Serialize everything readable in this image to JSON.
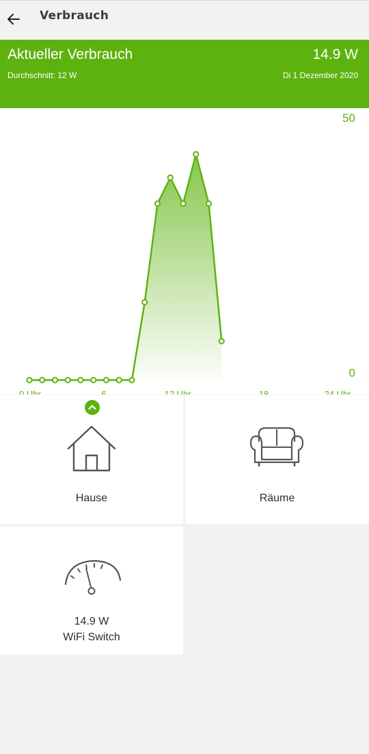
{
  "header": {
    "title": "Verbrauch"
  },
  "banner": {
    "title": "Aktueller Verbrauch",
    "value": "14.9 W",
    "average": "Durchschnitt: 12 W",
    "date": "Di 1 Dezember 2020"
  },
  "chart_data": {
    "type": "area",
    "ylim": [
      0,
      50
    ],
    "y_tick_labels": [
      "50",
      "0"
    ],
    "x_tick_labels": [
      "0 Uhr",
      "6",
      "12 Uhr",
      "18",
      "24 Uhr"
    ],
    "xlim": [
      0,
      24
    ],
    "color": "#5db210",
    "x": [
      0,
      1,
      2,
      3,
      4,
      5,
      6,
      7,
      8,
      9,
      10,
      11,
      12,
      13,
      14,
      15
    ],
    "values": [
      0,
      0,
      0,
      0,
      0,
      0,
      0,
      0,
      0,
      15,
      34,
      39,
      34,
      43.5,
      34,
      7.5
    ]
  },
  "tiles": [
    {
      "label": "Hause",
      "icon": "house-icon"
    },
    {
      "label": "Räume",
      "icon": "armchair-icon"
    },
    {
      "value": "14.9 W",
      "label": "WiFi Switch",
      "icon": "gauge-icon"
    }
  ],
  "colors": {
    "accent": "#5db210",
    "background": "#f2f2f2"
  }
}
